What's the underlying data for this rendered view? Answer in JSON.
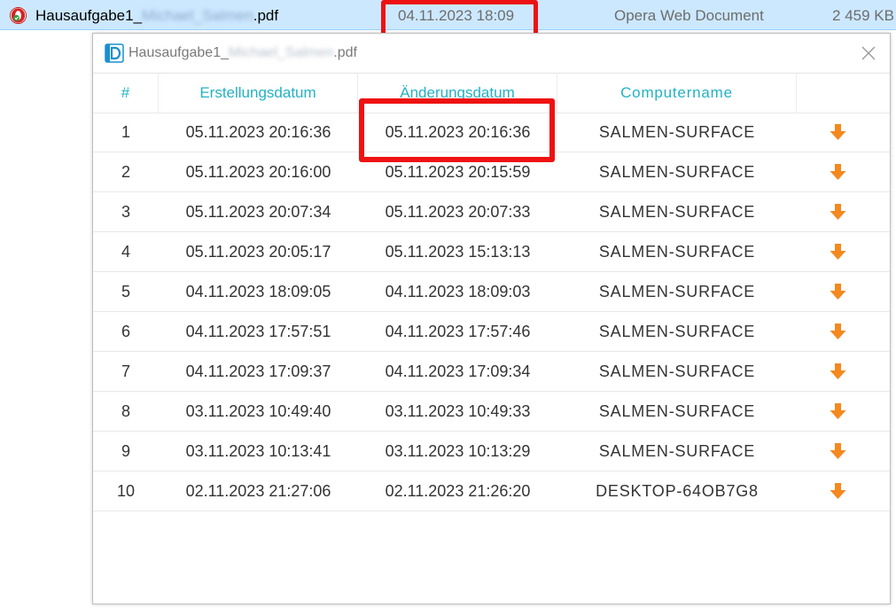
{
  "file_row": {
    "name_prefix": "Hausaufgabe1_",
    "name_redacted": "Michael_Salmen",
    "name_suffix": ".pdf",
    "date_modified": "04.11.2023 18:09",
    "type": "Opera Web Document",
    "size": "2 459 KB",
    "icon": "opera-pdf-icon"
  },
  "popup": {
    "title_prefix": "Hausaufgabe1_",
    "title_redacted": "Michael_Salmen",
    "title_suffix": ".pdf",
    "app_icon": "d-logo-icon",
    "close_icon": "close-icon"
  },
  "table": {
    "headers": [
      "#",
      "Erstellungsdatum",
      "Änderungsdatum",
      "Computername",
      ""
    ],
    "rows": [
      {
        "num": "1",
        "created": "05.11.2023 20:16:36",
        "modified": "05.11.2023 20:16:36",
        "computer": "SALMEN-SURFACE"
      },
      {
        "num": "2",
        "created": "05.11.2023 20:16:00",
        "modified": "05.11.2023 20:15:59",
        "computer": "SALMEN-SURFACE"
      },
      {
        "num": "3",
        "created": "05.11.2023 20:07:34",
        "modified": "05.11.2023 20:07:33",
        "computer": "SALMEN-SURFACE"
      },
      {
        "num": "4",
        "created": "05.11.2023 20:05:17",
        "modified": "05.11.2023 15:13:13",
        "computer": "SALMEN-SURFACE"
      },
      {
        "num": "5",
        "created": "04.11.2023 18:09:05",
        "modified": "04.11.2023 18:09:03",
        "computer": "SALMEN-SURFACE"
      },
      {
        "num": "6",
        "created": "04.11.2023 17:57:51",
        "modified": "04.11.2023 17:57:46",
        "computer": "SALMEN-SURFACE"
      },
      {
        "num": "7",
        "created": "04.11.2023 17:09:37",
        "modified": "04.11.2023 17:09:34",
        "computer": "SALMEN-SURFACE"
      },
      {
        "num": "8",
        "created": "03.11.2023 10:49:40",
        "modified": "03.11.2023 10:49:33",
        "computer": "SALMEN-SURFACE"
      },
      {
        "num": "9",
        "created": "03.11.2023 10:13:41",
        "modified": "03.11.2023 10:13:29",
        "computer": "SALMEN-SURFACE"
      },
      {
        "num": "10",
        "created": "02.11.2023 21:27:06",
        "modified": "02.11.2023 21:26:20",
        "computer": "DESKTOP-64OB7G8"
      }
    ],
    "download_icon": "download-arrow-icon"
  },
  "colors": {
    "header_text": "#22b2c4",
    "download_arrow": "#f5881f",
    "highlight": "#ee1111",
    "selection_bg": "#cce8ff"
  }
}
